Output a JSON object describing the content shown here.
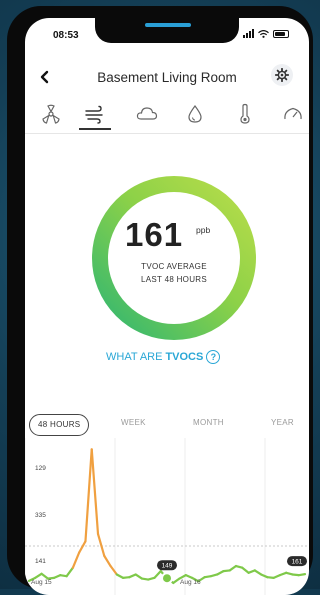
{
  "status_bar": {
    "time": "08:53"
  },
  "header": {
    "title": "Basement Living Room",
    "back_icon": "back-arrow-icon",
    "settings_icon": "gear-icon"
  },
  "sensor_tabs": [
    {
      "id": "radon",
      "icon": "radon-icon"
    },
    {
      "id": "airflow",
      "icon": "airflow-icon",
      "active": true
    },
    {
      "id": "humidity",
      "icon": "cloud-icon"
    },
    {
      "id": "moisture",
      "icon": "droplet-icon"
    },
    {
      "id": "temperature",
      "icon": "thermometer-icon"
    },
    {
      "id": "pressure",
      "icon": "gauge-icon"
    }
  ],
  "gauge": {
    "value": "161",
    "unit": "ppb",
    "label_line1": "TVOC AVERAGE",
    "label_line2": "LAST 48 HOURS",
    "gradient_colors": [
      "#2fb672",
      "#8cd148",
      "#b9dd4a"
    ]
  },
  "info_link": {
    "prefix": "WHAT ARE",
    "emphasis": "TVOCS",
    "icon": "help-icon",
    "color": "#2aa7d6"
  },
  "range_tabs": [
    {
      "label": "48 HOURS",
      "active": true
    },
    {
      "label": "WEEK"
    },
    {
      "label": "MONTH"
    },
    {
      "label": "YEAR"
    }
  ],
  "chart_data": {
    "type": "line",
    "y_labels": [
      "129",
      "335",
      "141"
    ],
    "x_labels": [
      "Aug 15",
      "Aug 16"
    ],
    "series": [
      {
        "values": [
          141,
          150,
          162,
          148,
          150,
          158,
          155,
          180,
          225,
          258,
          530,
          280,
          215,
          185,
          160,
          150,
          152,
          160,
          148,
          145,
          150,
          170,
          149,
          135,
          148,
          158,
          150,
          140,
          152,
          155,
          160,
          170,
          172,
          185,
          180,
          165,
          172,
          160,
          152,
          150,
          158,
          165,
          160,
          158,
          161
        ],
        "colors": {
          "normal": "#7fc94a",
          "elevated": "#f0a040"
        }
      }
    ],
    "markers": [
      {
        "index": 22,
        "label": "149"
      },
      {
        "index": 44,
        "label": "161"
      }
    ]
  }
}
